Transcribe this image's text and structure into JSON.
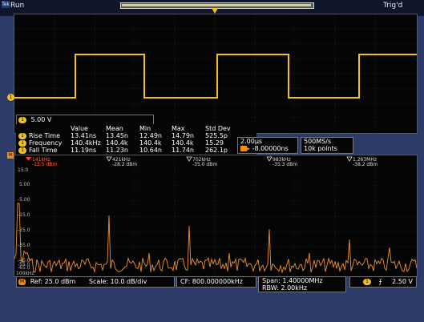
{
  "topbar": {
    "logo": "Tek",
    "status": "Run",
    "trigger_state": "Trig'd"
  },
  "channel1": {
    "badge": "1",
    "scale": "5.00 V"
  },
  "measurements": {
    "columns": [
      "Value",
      "Mean",
      "Min",
      "Max",
      "Std Dev"
    ],
    "rows": [
      {
        "name": "Rise Time",
        "values": [
          "13.41ns",
          "13.45n",
          "12.49n",
          "14.79n",
          "525.5p"
        ]
      },
      {
        "name": "Frequency",
        "values": [
          "140.4kHz",
          "140.4k",
          "140.4k",
          "140.4k",
          "15.29"
        ]
      },
      {
        "name": "Fall Time",
        "values": [
          "11.19ns",
          "11.23n",
          "10.64n",
          "11.74n",
          "262.1p"
        ]
      }
    ]
  },
  "timebase": {
    "time_div": "2.00µs",
    "delay": "-8.00000ns"
  },
  "acquisition": {
    "sample_rate": "500MS/s",
    "record_length": "10k points"
  },
  "spectrum": {
    "markers": [
      {
        "freq": "141kHz",
        "level": "-13.5 dBm",
        "ref": true
      },
      {
        "freq": "421kHz",
        "level": "-28.2 dBm"
      },
      {
        "freq": "702kHz",
        "level": "-35.0 dBm"
      },
      {
        "freq": "983kHz",
        "level": "-35.3 dBm"
      },
      {
        "freq": "1.263MHz",
        "level": "-38.2 dBm"
      }
    ],
    "y_labels": [
      "15.0",
      "5.00",
      "-5.00",
      "-15.0",
      "-25.0",
      "-35.0",
      "-45.0",
      "-55.0",
      "-65.0",
      "100kHz"
    ]
  },
  "bottom": {
    "math_badge": "M",
    "ref": "Ref: 25.0 dBm",
    "scale": "Scale: 10.0 dB/div",
    "cf": "CF: 800.000000kHz",
    "span": "Span:  1.40000MHz",
    "rbw": "RBW:   2.00kHz",
    "trig_level": "2.50 V",
    "trig_slope": "⨍"
  },
  "colors": {
    "ch1": "#f1c21b",
    "math": "#f08c1a",
    "background": "#2b3a67"
  }
}
